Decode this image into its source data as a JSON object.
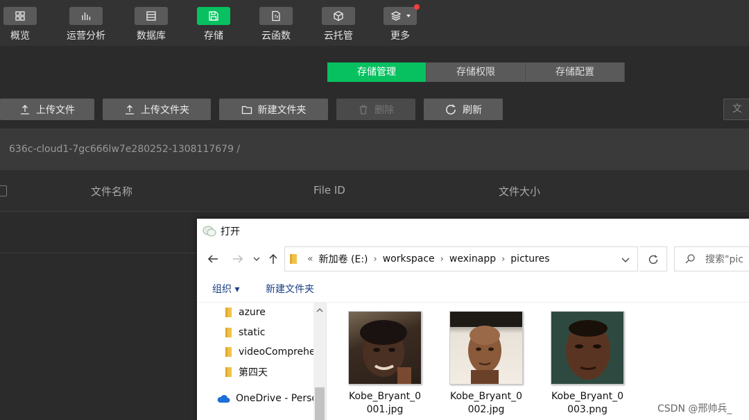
{
  "toolbar": {
    "items": [
      {
        "label": "概览",
        "icon": "grid-icon"
      },
      {
        "label": "运营分析",
        "icon": "bar-chart-icon"
      },
      {
        "label": "数据库",
        "icon": "database-icon"
      },
      {
        "label": "存储",
        "icon": "save-icon"
      },
      {
        "label": "云函数",
        "icon": "function-icon"
      },
      {
        "label": "云托管",
        "icon": "cube-icon"
      },
      {
        "label": "更多",
        "icon": "layers-icon"
      }
    ],
    "active_index": 3
  },
  "tabs": [
    {
      "label": "存储管理",
      "active": true
    },
    {
      "label": "存储权限",
      "active": false
    },
    {
      "label": "存储配置",
      "active": false
    }
  ],
  "actions": {
    "upload_file": "上传文件",
    "upload_folder": "上传文件夹",
    "new_folder": "新建文件夹",
    "delete": "删除",
    "refresh": "刷新",
    "search_placeholder": "文"
  },
  "path": "636c-cloud1-7gc666lw7e280252-1308117679  /",
  "table": {
    "columns": [
      "文件名称",
      "File ID",
      "文件大小"
    ]
  },
  "dialog": {
    "title": "打开",
    "address": {
      "prefix": "«",
      "segments": [
        "新加卷 (E:)",
        "workspace",
        "wexinapp",
        "pictures"
      ]
    },
    "search_placeholder": "搜索\"pic",
    "organize": "组织 ▾",
    "new_folder": "新建文件夹",
    "tree": [
      {
        "label": "azure",
        "icon": "folder-icon"
      },
      {
        "label": "static",
        "icon": "folder-icon"
      },
      {
        "label": "videoComprehe",
        "icon": "folder-icon"
      },
      {
        "label": "第四天",
        "icon": "folder-icon"
      },
      {
        "label": "OneDrive - Perso",
        "icon": "cloud-icon"
      }
    ],
    "files": [
      {
        "name": "Kobe_Bryant_0001.jpg"
      },
      {
        "name": "Kobe_Bryant_0002.jpg"
      },
      {
        "name": "Kobe_Bryant_0003.png"
      }
    ]
  },
  "watermark": "CSDN @邢帅兵_",
  "colors": {
    "accent": "#07c160",
    "background": "#2b2b2b",
    "badge": "#f43f3b"
  }
}
